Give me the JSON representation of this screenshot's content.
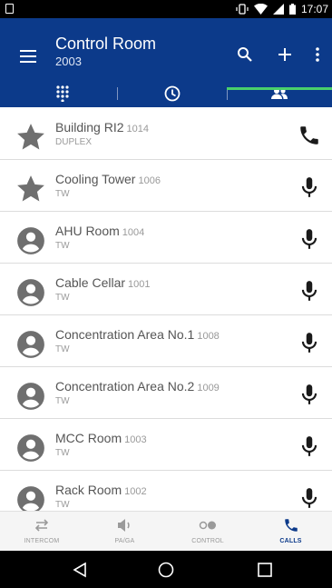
{
  "status_bar": {
    "time": "17:07"
  },
  "header": {
    "title": "Control Room",
    "subtitle": "2003",
    "icons": [
      "menu-icon",
      "search-icon",
      "add-icon",
      "more-vert-icon"
    ]
  },
  "tabs": [
    {
      "icon": "dialpad-icon"
    },
    {
      "icon": "history-icon"
    },
    {
      "icon": "contacts-icon",
      "selected": true
    }
  ],
  "contacts": [
    {
      "name": "Building RI2",
      "number": "1014",
      "type": "DUPLEX",
      "avatar": "star-icon",
      "action": "phone-icon"
    },
    {
      "name": "Cooling Tower",
      "number": "1006",
      "type": "TW",
      "avatar": "star-icon",
      "action": "mic-icon"
    },
    {
      "name": "AHU Room",
      "number": "1004",
      "type": "TW",
      "avatar": "person-icon",
      "action": "mic-icon"
    },
    {
      "name": "Cable Cellar",
      "number": "1001",
      "type": "TW",
      "avatar": "person-icon",
      "action": "mic-icon"
    },
    {
      "name": "Concentration Area No.1",
      "number": "1008",
      "type": "TW",
      "avatar": "person-icon",
      "action": "mic-icon"
    },
    {
      "name": "Concentration Area No.2",
      "number": "1009",
      "type": "TW",
      "avatar": "person-icon",
      "action": "mic-icon"
    },
    {
      "name": "MCC Room",
      "number": "1003",
      "type": "TW",
      "avatar": "person-icon",
      "action": "mic-icon"
    },
    {
      "name": "Rack Room",
      "number": "1002",
      "type": "TW",
      "avatar": "person-icon",
      "action": "mic-icon"
    }
  ],
  "bottom_nav": [
    {
      "label": "INTERCOM",
      "icon": "intercom-icon",
      "active": false
    },
    {
      "label": "PA/GA",
      "icon": "speaker-icon",
      "active": false
    },
    {
      "label": "CONTROL",
      "icon": "toggle-icon",
      "active": false
    },
    {
      "label": "CALLS",
      "icon": "phone-icon",
      "active": true
    }
  ],
  "colors": {
    "primary": "#0c3a8a",
    "accent": "#49d06b",
    "icon_dark": "#1a1a1a",
    "avatar_gray": "#6f6f6f",
    "nav_active": "#0c3a8a",
    "nav_inactive": "#9a9a9a"
  }
}
